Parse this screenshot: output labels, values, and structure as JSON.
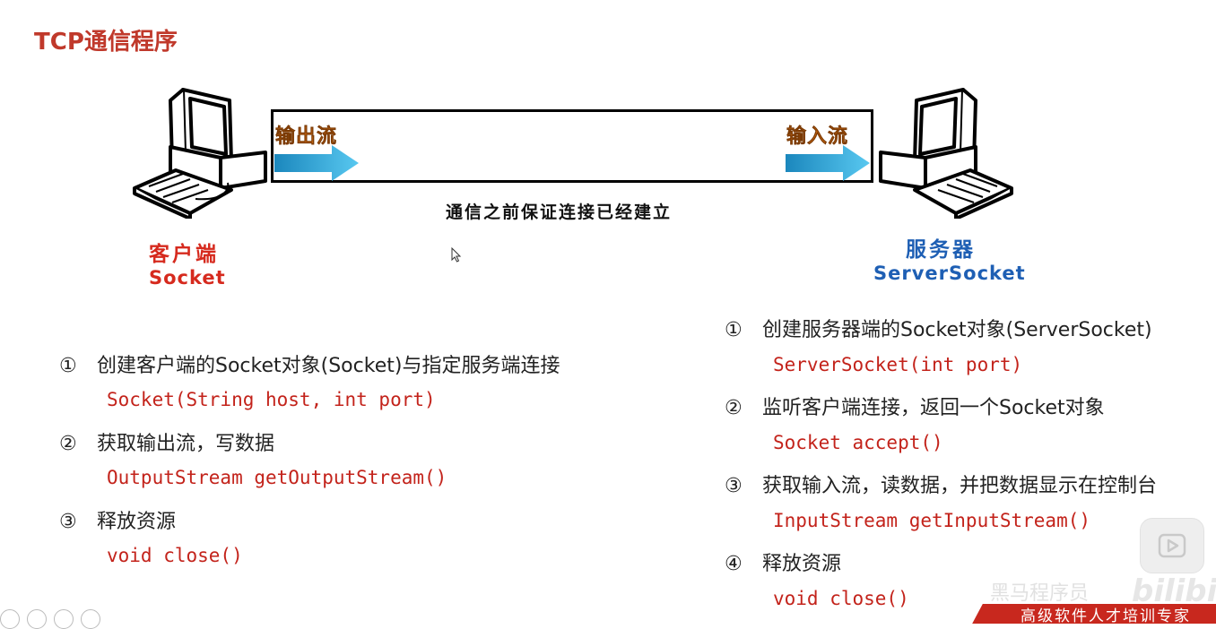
{
  "title": "TCP通信程序",
  "diagram": {
    "output_stream": "输出流",
    "input_stream": "输入流",
    "connection_note": "通信之前保证连接已经建立",
    "client": {
      "label": "客户端",
      "class_name": "Socket"
    },
    "server": {
      "label": "服务器",
      "class_name": "ServerSocket"
    }
  },
  "client_steps": [
    {
      "num": "①",
      "text": "创建客户端的Socket对象(Socket)与指定服务端连接",
      "code": "Socket(String host, int port)"
    },
    {
      "num": "②",
      "text": "获取输出流，写数据",
      "code": "OutputStream getOutputStream()"
    },
    {
      "num": "③",
      "text": "释放资源",
      "code": "void close()"
    }
  ],
  "server_steps": [
    {
      "num": "①",
      "text": "创建服务器端的Socket对象(ServerSocket)",
      "code": "ServerSocket(int port)"
    },
    {
      "num": "②",
      "text": "监听客户端连接，返回一个Socket对象",
      "code": "Socket accept()"
    },
    {
      "num": "③",
      "text": "获取输入流，读数据，并把数据显示在控制台",
      "code": "InputStream getInputStream()"
    },
    {
      "num": "④",
      "text": "释放资源",
      "code": "void close()"
    }
  ],
  "overlay": {
    "watermark_text": "黑马程序员",
    "watermark_logo": "bilibili",
    "brand_text": "高级软件人才培训专家",
    "play_icon": "play-icon",
    "cursor_icon": "mouse-cursor-icon"
  },
  "colors": {
    "title": "#c0392b",
    "client_label": "#d62a1e",
    "server_label": "#1e5fb4",
    "stream_label": "#ee7a14",
    "code": "#c3231b",
    "arrow": "#2aa7de"
  }
}
